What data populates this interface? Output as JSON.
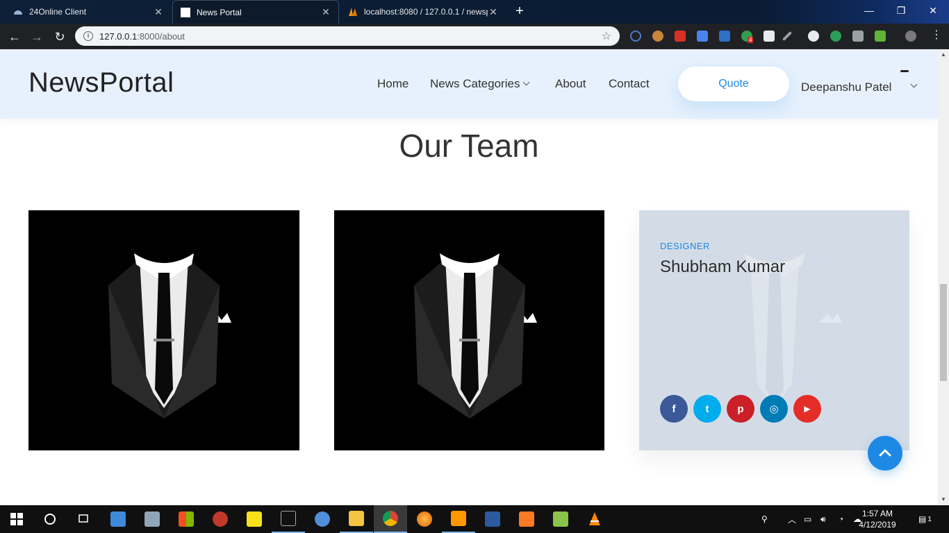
{
  "browser": {
    "tabs": [
      {
        "title": "24Online Client",
        "active": false
      },
      {
        "title": "News Portal",
        "active": true
      },
      {
        "title": "localhost:8080 / 127.0.0.1 / newsp",
        "active": false
      }
    ],
    "url_host": "127.0.0.1",
    "url_path": ":8000/about",
    "extension_badge": "4"
  },
  "site": {
    "brand": "NewsPortal",
    "nav": {
      "home": "Home",
      "categories": "News Categories",
      "about": "About",
      "contact": "Contact"
    },
    "quote_button": "Quote",
    "user_name": "Deepanshu Patel"
  },
  "team": {
    "title": "Our Team",
    "featured": {
      "role": "DESIGNER",
      "name": "Shubham Kumar"
    },
    "socials": [
      {
        "icon": "facebook-icon",
        "glyph": "f",
        "color": "#3b5998"
      },
      {
        "icon": "twitter-icon",
        "glyph": "t",
        "color": "#00aced"
      },
      {
        "icon": "pinterest-icon",
        "glyph": "p",
        "color": "#cb2027"
      },
      {
        "icon": "instagram-icon",
        "glyph": "◎",
        "color": "#007bb6"
      },
      {
        "icon": "youtube-icon",
        "glyph": "▶",
        "color": "#e52d27"
      }
    ]
  },
  "taskbar": {
    "time": "1:57 AM",
    "date": "4/12/2019",
    "notifications": "1"
  },
  "colors": {
    "accent": "#1e88e5",
    "header_bg": "#e6f1fd",
    "card_bg": "#d3dce6"
  }
}
